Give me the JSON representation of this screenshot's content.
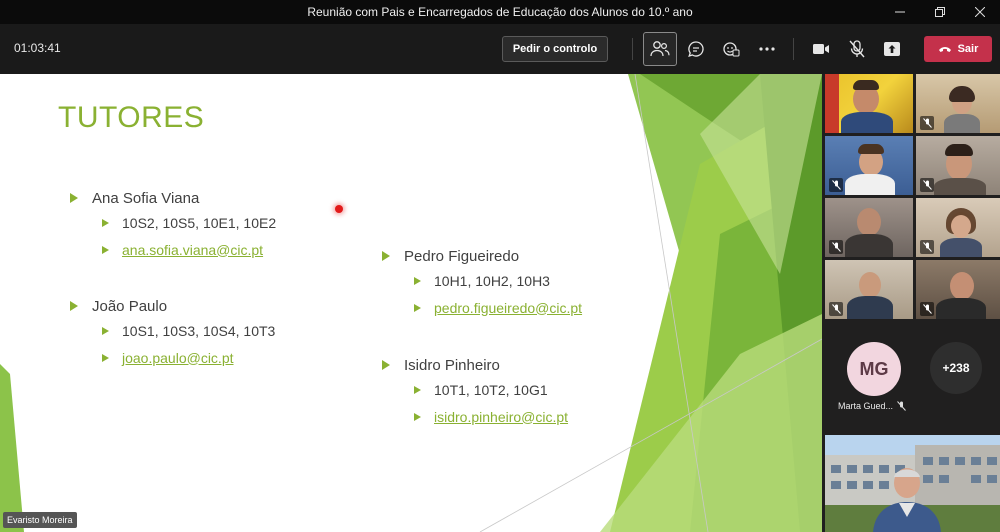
{
  "window": {
    "title": "Reunião com Pais e Encarregados de Educação dos Alunos do 10.º ano",
    "controls": [
      "minimize-icon",
      "restore-icon",
      "close-icon"
    ]
  },
  "toolbar": {
    "timer": "01:03:41",
    "request_control_label": "Pedir o controlo",
    "leave_label": "Sair",
    "icons": [
      "people-icon",
      "chat-icon",
      "reactions-icon",
      "more-icon",
      "camera-icon",
      "mic-off-icon",
      "share-icon",
      "phone-hangup-icon"
    ],
    "leave_color": "#c4314b"
  },
  "slide": {
    "title": "TUTORES",
    "accent_color": "#8ab132",
    "tutors": [
      {
        "name": "Ana Sofia Viana",
        "classes": "10S2, 10S5, 10E1, 10E2",
        "email": "ana.sofia.viana@cic.pt"
      },
      {
        "name": "João Paulo",
        "classes": "10S1, 10S3, 10S4, 10T3",
        "email": "joao.paulo@cic.pt"
      },
      {
        "name": "Pedro Figueiredo",
        "classes": "10H1, 10H2, 10H3",
        "email": "pedro.figueiredo@cic.pt"
      },
      {
        "name": "Isidro Pinheiro",
        "classes": "10T1, 10T2, 10G1",
        "email": "isidro.pinheiro@cic.pt"
      }
    ],
    "presenter_name": "Evaristo Moreira"
  },
  "participants": {
    "avatar_initials": "MG",
    "avatar_name": "Marta Gued...",
    "more_count": "+238"
  }
}
